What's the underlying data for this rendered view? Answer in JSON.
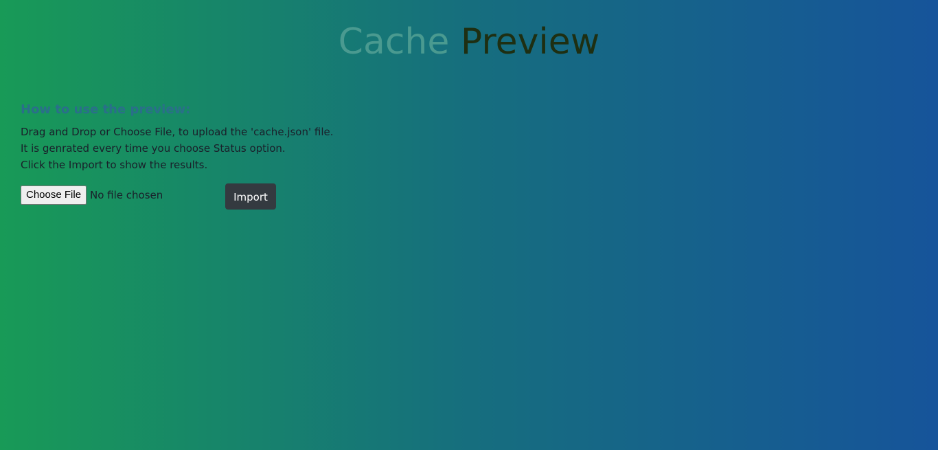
{
  "header": {
    "title_part1": "Cache",
    "title_part2": "Preview"
  },
  "instructions": {
    "heading": "How to use the preview:",
    "lines": [
      "Drag and Drop or Choose File, to upload the 'cache.json' file.",
      "It is genrated every time you choose Status option.",
      "Click the Import to show the results."
    ]
  },
  "upload": {
    "choose_file_label": "Choose File",
    "file_status": "No file chosen",
    "import_label": "Import"
  },
  "colors": {
    "gradient_start": "#189a57",
    "gradient_end": "#16549a",
    "title_part1": "#4a9a90",
    "title_part2": "#1e2f12",
    "heading": "#2a6f8a",
    "import_button_bg": "#343a40"
  }
}
